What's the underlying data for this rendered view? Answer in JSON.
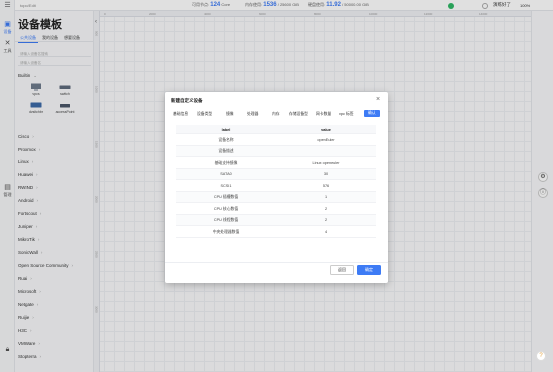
{
  "topbar": {
    "crumb": "topo/Edit",
    "stat_nodes_label": "可用节点:",
    "stat_nodes_value": "124",
    "stat_nodes_unit": "Core",
    "stat_mem_label": "内存使用:",
    "stat_mem_value": "1536",
    "stat_mem_unit": "/ 25600 GiB",
    "stat_disk_label": "硬盘使用:",
    "stat_disk_value": "11.92",
    "stat_disk_unit": "/ 50000.00 GiB",
    "status_label": "演练好了",
    "zoom": "100%",
    "status_color": "#2fb866"
  },
  "rail": {
    "items": [
      {
        "label": "设备",
        "icon": "device-icon"
      },
      {
        "label": "工具",
        "icon": "tool-icon"
      },
      {
        "label": "管理",
        "icon": "manage-icon"
      }
    ]
  },
  "panel": {
    "title": "设备模板",
    "tabs": [
      "公共设备",
      "我的设备",
      "想要设备"
    ],
    "search1_placeholder": "请输入设备名搜索",
    "search2_placeholder": "请输入设备名",
    "builtin_group": "Builtin",
    "devices": [
      {
        "label": "vpcs",
        "icon": "pc-icon"
      },
      {
        "label": "switch",
        "icon": "switch-icon"
      },
      {
        "label": "dvsitchbr",
        "icon": "switch-icon"
      },
      {
        "label": "accessPoint",
        "icon": "ap-icon"
      }
    ],
    "groups": [
      "Cisco",
      "Proxmox",
      "Linux",
      "Huawei",
      "RWIND",
      "Android",
      "Fortscout",
      "Juniper",
      "MikroTik",
      "SonicWall",
      "Open Source Community",
      "Ruai",
      "Microsoft",
      "Netgate",
      "Ruijie",
      "H3C",
      "VMWare",
      "Stopterra"
    ]
  },
  "dialog": {
    "title": "新建自定义设备",
    "tabs": [
      "基础信息",
      "设备类型",
      "镜像",
      "处理器",
      "内存",
      "存储设备型",
      "网卡数量",
      "vpc 标签",
      "确认"
    ],
    "active_tab": 8,
    "columns": [
      "label",
      "value"
    ],
    "rows": [
      {
        "label": "设备名称",
        "value": "openEuler"
      },
      {
        "label": "设备描述",
        "value": ""
      },
      {
        "label": "基础支持镜像",
        "value": "Linux openeuler"
      },
      {
        "label": "SATA0",
        "value": "30"
      },
      {
        "label": "SCSI1",
        "value": "576"
      },
      {
        "label": "CPU 插槽数值",
        "value": "1"
      },
      {
        "label": "CPU 核心数值",
        "value": "2"
      },
      {
        "label": "CPU 线程数值",
        "value": "2"
      },
      {
        "label": "中央处理器数值",
        "value": "4"
      }
    ],
    "cancel_label": "返回",
    "ok_label": "确定",
    "accent": "#3d7bf5"
  },
  "ruler": {
    "h_ticks": [
      "0",
      "2000",
      "4000",
      "6000",
      "8000",
      "10000",
      "12000",
      "14000"
    ],
    "v_ticks": [
      "500",
      "1000",
      "1500",
      "2000",
      "2500",
      "3000"
    ]
  }
}
